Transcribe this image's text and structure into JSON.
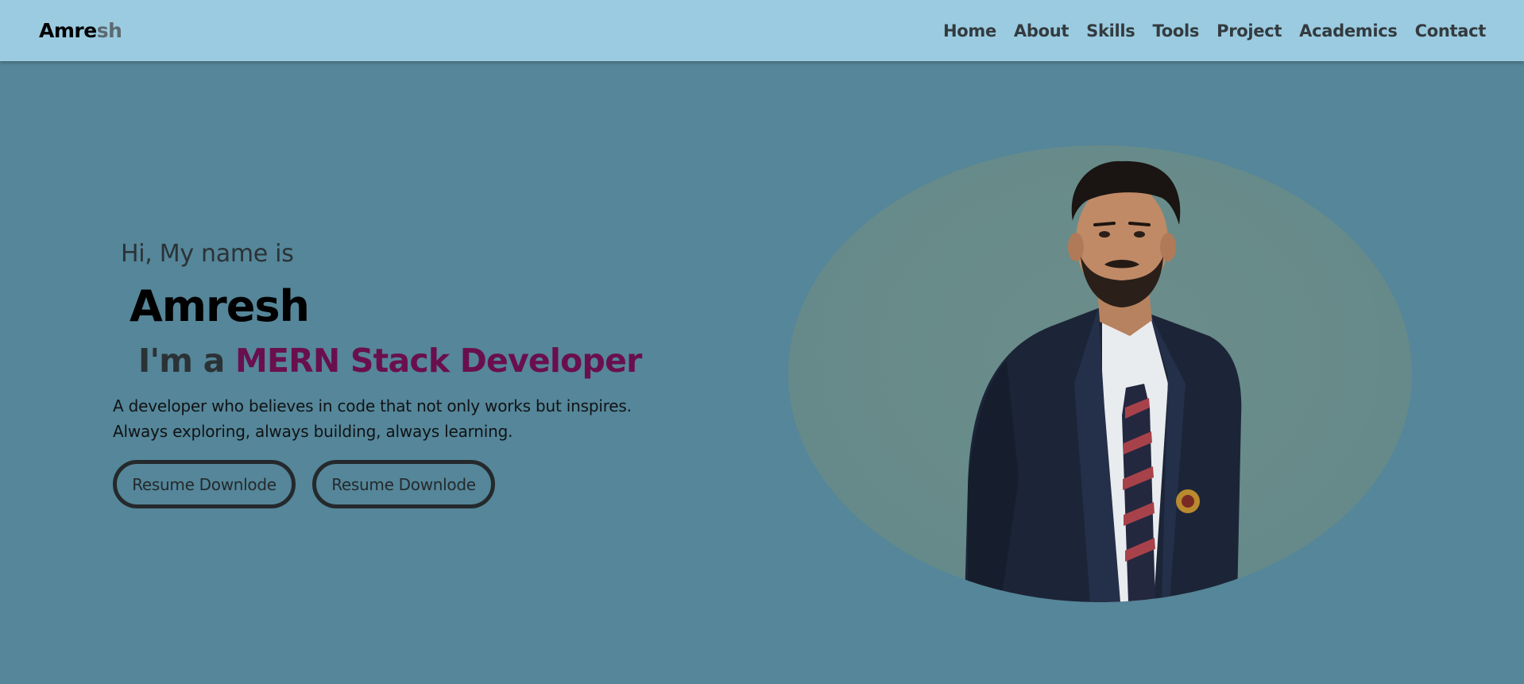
{
  "brand": {
    "part1": "Amre",
    "part2": "sh"
  },
  "nav": {
    "items": [
      {
        "label": "Home"
      },
      {
        "label": "About"
      },
      {
        "label": "Skills"
      },
      {
        "label": "Tools"
      },
      {
        "label": "Project"
      },
      {
        "label": "Academics"
      },
      {
        "label": "Contact"
      }
    ]
  },
  "hero": {
    "greeting": "Hi, My name is",
    "name": "Amresh",
    "role_prefix": "I'm a ",
    "role_accent": "MERN Stack Developer",
    "description": "A developer who believes in code that not only works but inspires. Always exploring, always building, always learning.",
    "buttons": [
      {
        "label": "Resume Downlode"
      },
      {
        "label": "Resume Downlode"
      }
    ]
  },
  "colors": {
    "background": "#558699",
    "navbar": "#9bcbe0",
    "accent": "#6a0f4d",
    "portrait_bg": "#678b8a"
  }
}
